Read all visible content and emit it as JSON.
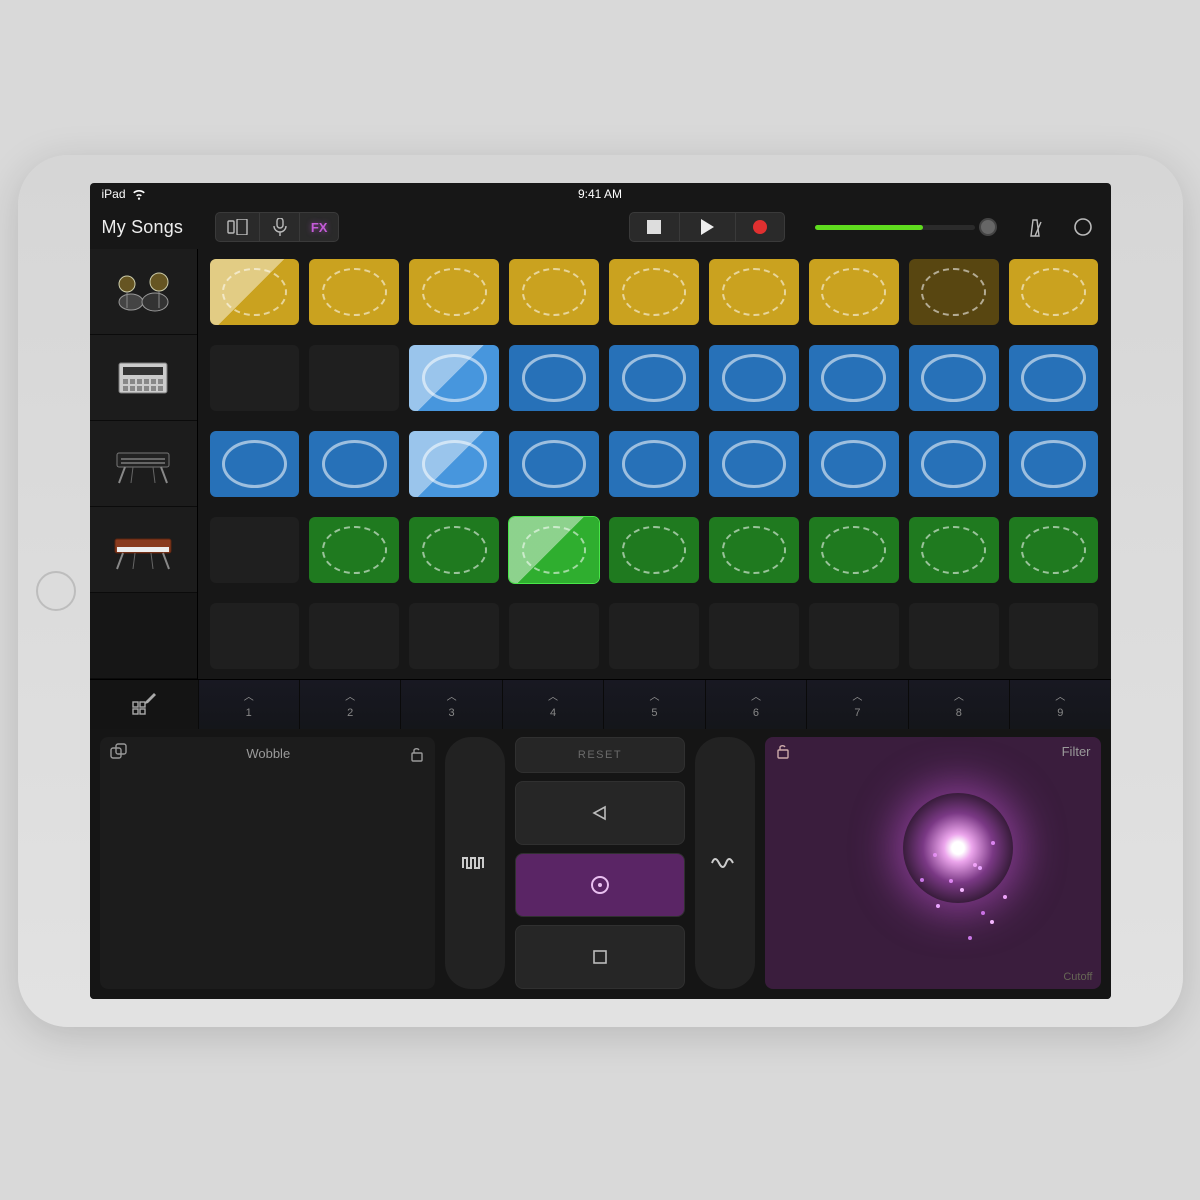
{
  "status": {
    "device": "iPad",
    "time": "9:41 AM"
  },
  "toolbar": {
    "back": "My Songs",
    "fx": "FX"
  },
  "volume": {
    "percent": 68
  },
  "tracks": [
    {
      "instrument": "drums"
    },
    {
      "instrument": "sampler"
    },
    {
      "instrument": "keyboard"
    },
    {
      "instrument": "synth"
    }
  ],
  "triggers": [
    "1",
    "2",
    "3",
    "4",
    "5",
    "6",
    "7",
    "8",
    "9"
  ],
  "fx_panel": {
    "left": {
      "name": "Wobble"
    },
    "center": {
      "reset": "RESET"
    },
    "right": {
      "name": "Filter",
      "axis": "Cutoff"
    }
  },
  "grid": [
    [
      {
        "c": "yellow",
        "f": 1,
        "p": 1
      },
      {
        "c": "yellow",
        "f": 1
      },
      {
        "c": "yellow",
        "f": 1
      },
      {
        "c": "yellow",
        "f": 1
      },
      {
        "c": "yellow",
        "f": 1
      },
      {
        "c": "yellow",
        "f": 1
      },
      {
        "c": "yellow",
        "f": 1
      },
      {
        "c": "yellow dim",
        "f": 1
      },
      {
        "c": "yellow",
        "f": 1
      }
    ],
    [
      {
        "c": "",
        "f": 0
      },
      {
        "c": "",
        "f": 0
      },
      {
        "c": "blue lt",
        "f": 1,
        "p": 1,
        "w": 1
      },
      {
        "c": "blue",
        "f": 1,
        "w": 1
      },
      {
        "c": "blue",
        "f": 1,
        "w": 1
      },
      {
        "c": "blue",
        "f": 1,
        "w": 1
      },
      {
        "c": "blue",
        "f": 1,
        "w": 1
      },
      {
        "c": "blue",
        "f": 1,
        "w": 1
      },
      {
        "c": "blue",
        "f": 1,
        "w": 1
      }
    ],
    [
      {
        "c": "blue",
        "f": 1,
        "w": 1
      },
      {
        "c": "blue",
        "f": 1,
        "w": 1
      },
      {
        "c": "blue lt",
        "f": 1,
        "p": 1,
        "w": 1
      },
      {
        "c": "blue",
        "f": 1,
        "w": 1
      },
      {
        "c": "blue",
        "f": 1,
        "w": 1
      },
      {
        "c": "blue",
        "f": 1,
        "w": 1
      },
      {
        "c": "blue",
        "f": 1,
        "w": 1
      },
      {
        "c": "blue",
        "f": 1,
        "w": 1
      },
      {
        "c": "blue",
        "f": 1,
        "w": 1
      }
    ],
    [
      {
        "c": "",
        "f": 0
      },
      {
        "c": "green",
        "f": 1
      },
      {
        "c": "green",
        "f": 1
      },
      {
        "c": "green lt",
        "f": 1,
        "p": 1
      },
      {
        "c": "green",
        "f": 1
      },
      {
        "c": "green",
        "f": 1
      },
      {
        "c": "green",
        "f": 1
      },
      {
        "c": "green",
        "f": 1
      },
      {
        "c": "green",
        "f": 1
      }
    ]
  ]
}
